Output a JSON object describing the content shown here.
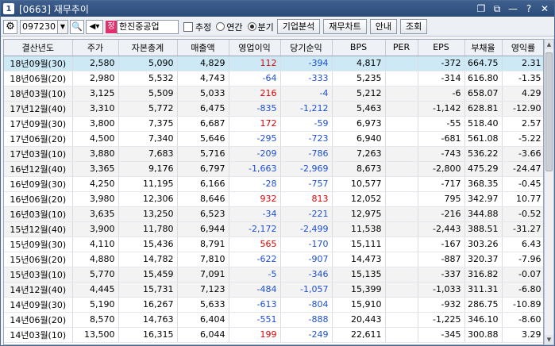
{
  "window": {
    "number": "1",
    "title": "[0663] 재무추이",
    "controls": [
      "restore-icon",
      "copy-icon",
      "minimize-icon",
      "help-icon",
      "close-icon"
    ]
  },
  "toolbar": {
    "stock_code": "097230",
    "badge": "정",
    "company": "한진중공업",
    "estimate_label": "추정",
    "annual_label": "연간",
    "quarter_label": "분기",
    "selected_period": "분기",
    "buttons": [
      "기업분석",
      "재무차트",
      "안내",
      "조회"
    ]
  },
  "table": {
    "columns": [
      "결산년도",
      "주가",
      "자본총계",
      "매출액",
      "영업이익",
      "당기순익",
      "BPS",
      "PER",
      "EPS",
      "부채율",
      "영익률"
    ],
    "rows": [
      [
        "18년09월(30)",
        "2,580",
        "5,090",
        "4,829",
        "112",
        "-394",
        "4,817",
        "",
        "-372",
        "664.75",
        "2.31"
      ],
      [
        "18년06월(20)",
        "2,980",
        "5,532",
        "4,743",
        "-64",
        "-333",
        "5,235",
        "",
        "-314",
        "616.80",
        "-1.35"
      ],
      [
        "18년03월(10)",
        "3,125",
        "5,509",
        "5,033",
        "216",
        "-4",
        "5,212",
        "",
        "-6",
        "658.07",
        "4.29"
      ],
      [
        "17년12월(40)",
        "3,310",
        "5,772",
        "6,475",
        "-835",
        "-1,212",
        "5,463",
        "",
        "-1,142",
        "628.81",
        "-12.90"
      ],
      [
        "17년09월(30)",
        "3,800",
        "7,375",
        "6,687",
        "172",
        "-59",
        "6,973",
        "",
        "-55",
        "518.40",
        "2.57"
      ],
      [
        "17년06월(20)",
        "4,500",
        "7,340",
        "5,646",
        "-295",
        "-723",
        "6,940",
        "",
        "-681",
        "561.08",
        "-5.22"
      ],
      [
        "17년03월(10)",
        "3,880",
        "7,683",
        "5,716",
        "-209",
        "-786",
        "7,263",
        "",
        "-743",
        "536.22",
        "-3.66"
      ],
      [
        "16년12월(40)",
        "3,365",
        "9,176",
        "6,797",
        "-1,663",
        "-2,969",
        "8,673",
        "",
        "-2,800",
        "475.29",
        "-24.47"
      ],
      [
        "16년09월(30)",
        "4,250",
        "11,195",
        "6,166",
        "-28",
        "-757",
        "10,577",
        "",
        "-717",
        "368.35",
        "-0.45"
      ],
      [
        "16년06월(20)",
        "3,980",
        "12,306",
        "8,646",
        "932",
        "813",
        "12,052",
        "",
        "795",
        "342.97",
        "10.77"
      ],
      [
        "16년03월(10)",
        "3,635",
        "13,250",
        "6,523",
        "-34",
        "-221",
        "12,975",
        "",
        "-216",
        "344.88",
        "-0.52"
      ],
      [
        "15년12월(40)",
        "3,900",
        "11,780",
        "6,944",
        "-2,172",
        "-2,499",
        "11,538",
        "",
        "-2,443",
        "388.51",
        "-31.27"
      ],
      [
        "15년09월(30)",
        "4,110",
        "15,436",
        "8,791",
        "565",
        "-170",
        "15,111",
        "",
        "-167",
        "303.26",
        "6.43"
      ],
      [
        "15년06월(20)",
        "4,880",
        "14,782",
        "7,810",
        "-622",
        "-907",
        "14,473",
        "",
        "-887",
        "320.37",
        "-7.96"
      ],
      [
        "15년03월(10)",
        "5,770",
        "15,459",
        "7,091",
        "-5",
        "-346",
        "15,135",
        "",
        "-337",
        "316.82",
        "-0.07"
      ],
      [
        "14년12월(40)",
        "4,445",
        "15,731",
        "7,123",
        "-484",
        "-1,057",
        "15,399",
        "",
        "-1,033",
        "311.31",
        "-6.80"
      ],
      [
        "14년09월(30)",
        "5,190",
        "16,267",
        "5,633",
        "-613",
        "-804",
        "15,910",
        "",
        "-932",
        "286.75",
        "-10.89"
      ],
      [
        "14년06월(20)",
        "8,570",
        "14,763",
        "6,404",
        "-551",
        "-888",
        "20,443",
        "",
        "-1,225",
        "346.10",
        "-8.60"
      ],
      [
        "14년03월(10)",
        "13,500",
        "16,315",
        "6,044",
        "199",
        "-249",
        "22,611",
        "",
        "-345",
        "300.88",
        "3.29"
      ]
    ]
  },
  "colors": {
    "positive": "#e00000",
    "negative": "#1c4fd6",
    "selected_row": "#cde9f6",
    "title_bar": "#2b4a78"
  }
}
